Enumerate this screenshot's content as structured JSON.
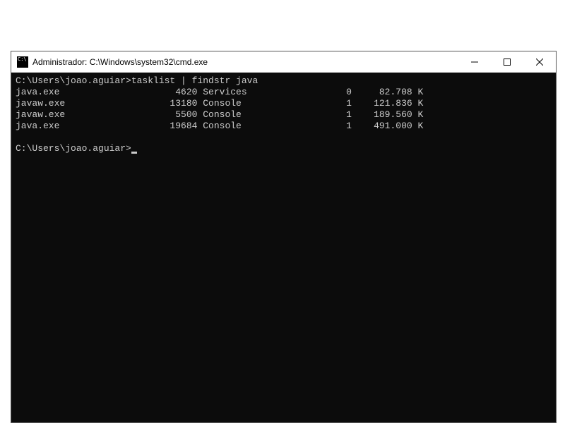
{
  "window": {
    "title": "Administrador: C:\\Windows\\system32\\cmd.exe"
  },
  "console": {
    "prompt1": "C:\\Users\\joao.aguiar>",
    "command1": "tasklist | findstr java",
    "rows": [
      {
        "name": "java.exe",
        "pid": "4620",
        "session_name": "Services",
        "session_num": "0",
        "mem": "82.708 K"
      },
      {
        "name": "javaw.exe",
        "pid": "13180",
        "session_name": "Console",
        "session_num": "1",
        "mem": "121.836 K"
      },
      {
        "name": "javaw.exe",
        "pid": "5500",
        "session_name": "Console",
        "session_num": "1",
        "mem": "189.560 K"
      },
      {
        "name": "java.exe",
        "pid": "19684",
        "session_name": "Console",
        "session_num": "1",
        "mem": "491.000 K"
      }
    ],
    "prompt2": "C:\\Users\\joao.aguiar>"
  }
}
